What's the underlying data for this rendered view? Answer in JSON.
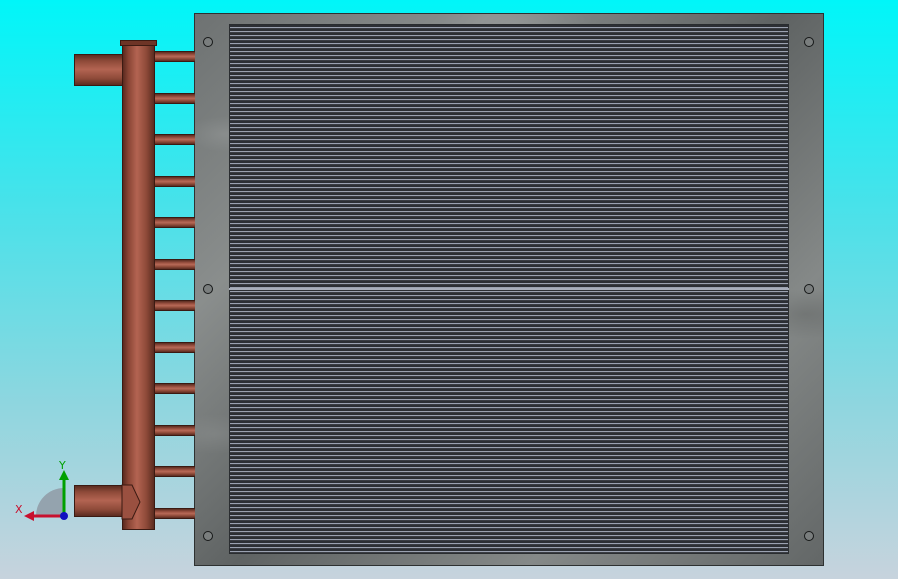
{
  "viewport": {
    "model": "heat-exchanger-coil",
    "tube_count": 12,
    "mounting_hole_count": 6,
    "colors": {
      "background_top": "#00f6f9",
      "background_bottom": "#c7d3dd",
      "copper": "#b36452",
      "frame": "#7c8080",
      "fins": "#2c2f34"
    }
  },
  "triad": {
    "x_label": "X",
    "y_label": "Y",
    "x_color": "#c8102e",
    "y_color": "#00a000",
    "z_color": "#1010c0"
  }
}
